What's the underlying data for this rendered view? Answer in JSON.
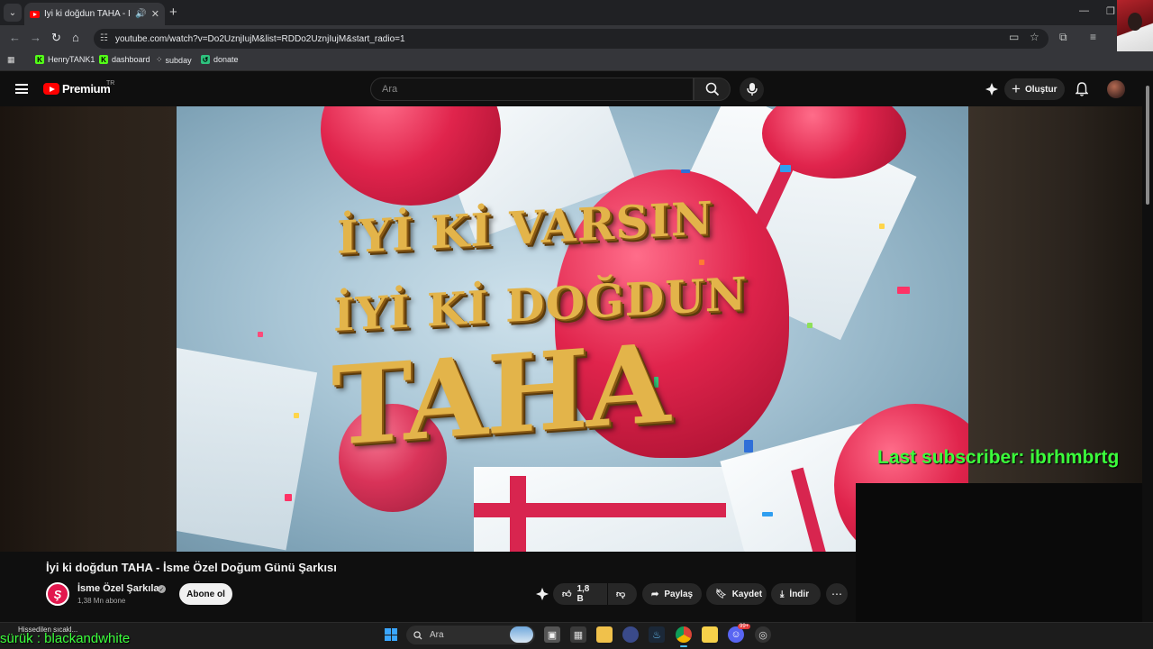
{
  "browser": {
    "tab": {
      "title": "İyi ki doğdun TAHA - İsme Ö"
    },
    "url": "youtube.com/watch?v=Do2UznjIujM&list=RDDo2UznjIujM&start_radio=1",
    "bookmarks": [
      {
        "label": "HenryTANK1"
      },
      {
        "label": "dashboard"
      },
      {
        "label": "subday"
      },
      {
        "label": "donate"
      }
    ]
  },
  "youtube": {
    "logo_text": "Premium",
    "country_code": "TR",
    "search_placeholder": "Ara",
    "create_label": "Oluştur"
  },
  "video": {
    "text_line1": "İYİ Kİ VARSIN",
    "text_line2": "İYİ Kİ DOĞDUN",
    "text_name": "TAHA",
    "title": "İyi ki doğdun TAHA - İsme Özel Doğum Günü Şarkısı",
    "channel_name": "İsme Özel Şarkılar",
    "channel_initial": "Ş",
    "subscribers": "1,38 Mn abone",
    "subscribe_label": "Abone ol",
    "likes": "1,8 B",
    "share_label": "Paylaş",
    "save_label": "Kaydet",
    "download_label": "İndir"
  },
  "stream_overlay": {
    "last_subscriber": "Last subscriber: ibrhmbrtg",
    "user_line": "sürük : blackandwhite"
  },
  "taskbar": {
    "weather": "Hissedilen sıcakl...",
    "search_label": "Ara",
    "notification_count": "99+"
  },
  "colors": {
    "youtube_red": "#ff0000",
    "overlay_green": "#3bff3b",
    "background": "#0f0f0f"
  }
}
